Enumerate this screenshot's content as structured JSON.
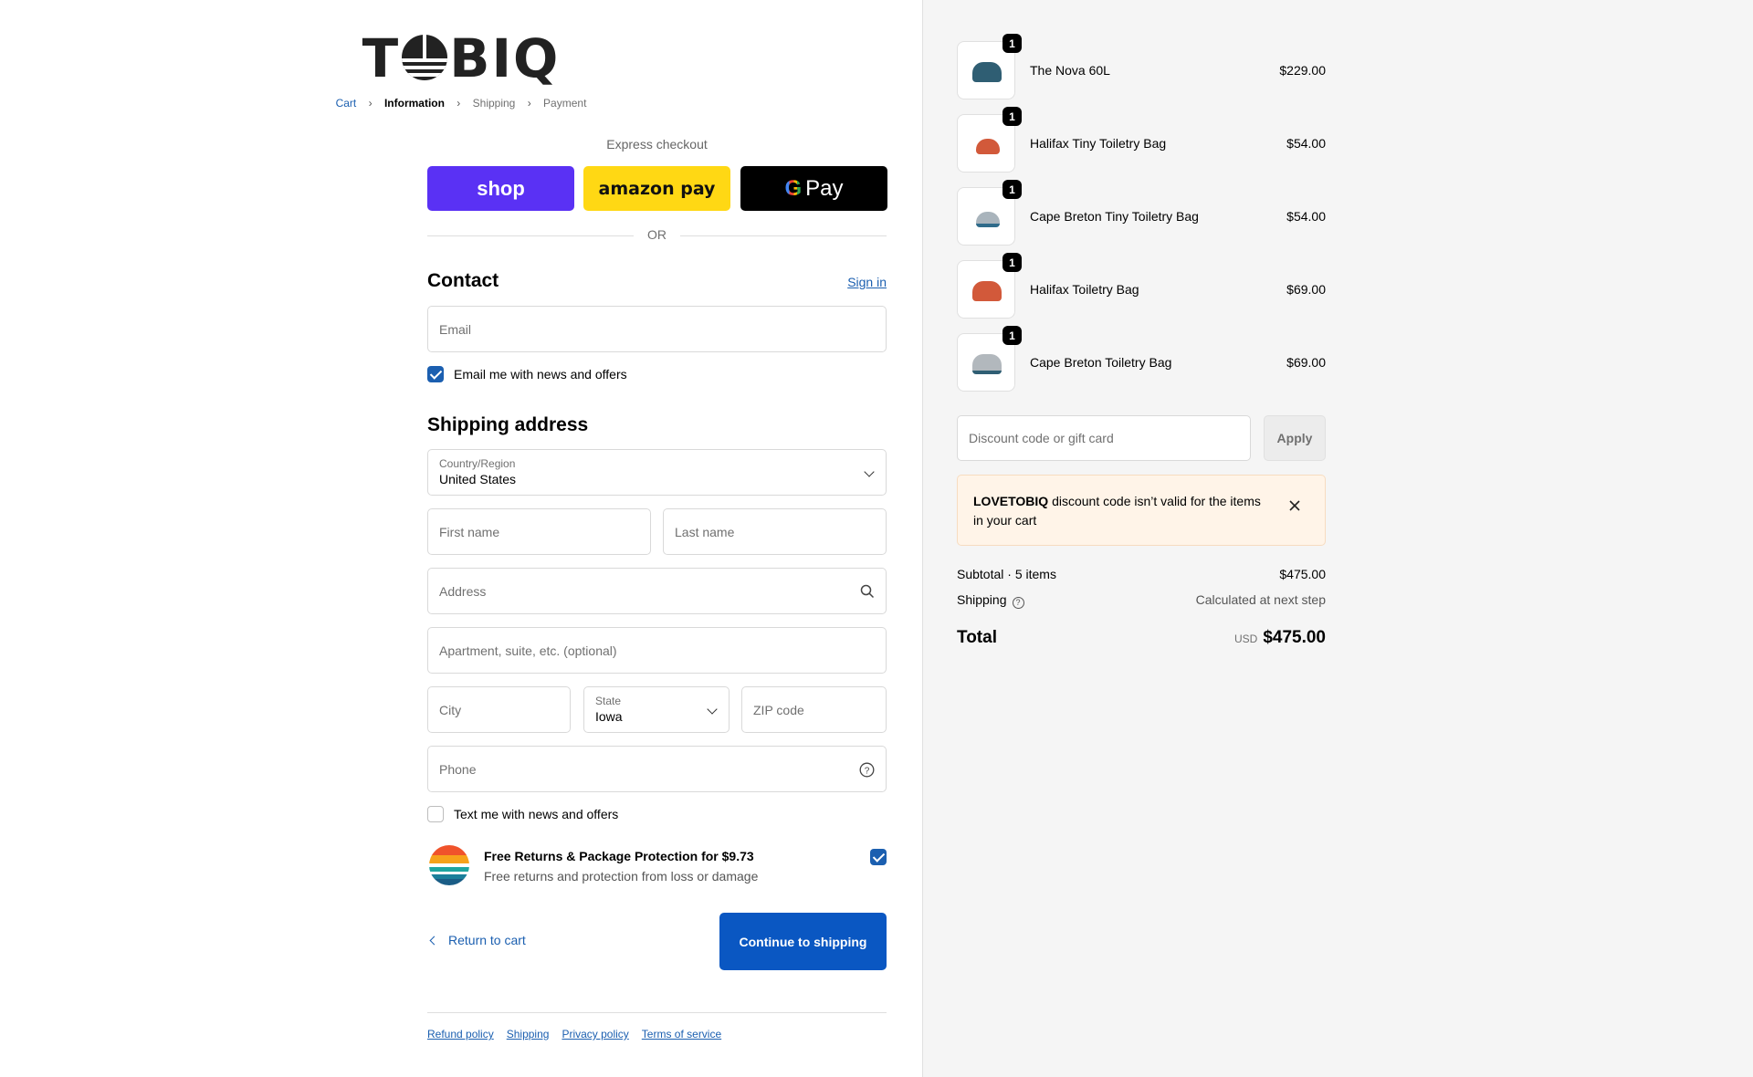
{
  "brand": {
    "logo_text_left": "T",
    "logo_text_right": "BIQ"
  },
  "breadcrumb": {
    "items": [
      "Cart",
      "Information",
      "Shipping",
      "Payment"
    ]
  },
  "express": {
    "title": "Express checkout",
    "shop_pay": "shop",
    "amazon_pay": "amazon pay",
    "google_pay": "Pay",
    "or": "OR"
  },
  "contact": {
    "heading": "Contact",
    "sign_in": "Sign in",
    "email_placeholder": "Email",
    "news_label": "Email me with news and offers",
    "news_checked": true
  },
  "shipping": {
    "heading": "Shipping address",
    "country_label": "Country/Region",
    "country_value": "United States",
    "first_name_placeholder": "First name",
    "last_name_placeholder": "Last name",
    "address_placeholder": "Address",
    "apartment_placeholder": "Apartment, suite, etc. (optional)",
    "city_placeholder": "City",
    "state_label": "State",
    "state_value": "Iowa",
    "zip_placeholder": "ZIP code",
    "phone_placeholder": "Phone",
    "text_label": "Text me with news and offers",
    "text_checked": false
  },
  "protection": {
    "title": "Free Returns & Package Protection for $9.73",
    "subtitle": "Free returns and protection from loss or damage",
    "checked": true
  },
  "actions": {
    "back": "Return to cart",
    "continue": "Continue to shipping"
  },
  "footer": {
    "links": [
      "Refund policy",
      "Shipping",
      "Privacy policy",
      "Terms of service"
    ]
  },
  "cart": {
    "items": [
      {
        "name": "The Nova 60L",
        "price": "$229.00",
        "qty": "1",
        "color": "#2f5e73"
      },
      {
        "name": "Halifax Tiny Toiletry Bag",
        "price": "$54.00",
        "qty": "1",
        "color": "#d2593a"
      },
      {
        "name": "Cape Breton Tiny Toiletry Bag",
        "price": "$54.00",
        "qty": "1",
        "color": "#a9b4bc"
      },
      {
        "name": "Halifax Toiletry Bag",
        "price": "$69.00",
        "qty": "1",
        "color": "#d2593a"
      },
      {
        "name": "Cape Breton Toiletry Bag",
        "price": "$69.00",
        "qty": "1",
        "color": "#b2b8bd"
      }
    ],
    "discount_placeholder": "Discount code or gift card",
    "apply": "Apply",
    "alert_code": "LOVETOBIQ",
    "alert_text": " discount code isn’t valid for the items in your cart",
    "subtotal_label": "Subtotal · 5 items",
    "subtotal_value": "$475.00",
    "shipping_label": "Shipping",
    "shipping_value": "Calculated at next step",
    "total_label": "Total",
    "currency": "USD",
    "total_value": "$475.00"
  },
  "colors": {
    "accent": "#1b5fb0",
    "button": "#0a57c2",
    "shop_pay": "#5a31f4",
    "amazon_pay": "#ffd814",
    "alert_bg": "#fff4e8"
  }
}
